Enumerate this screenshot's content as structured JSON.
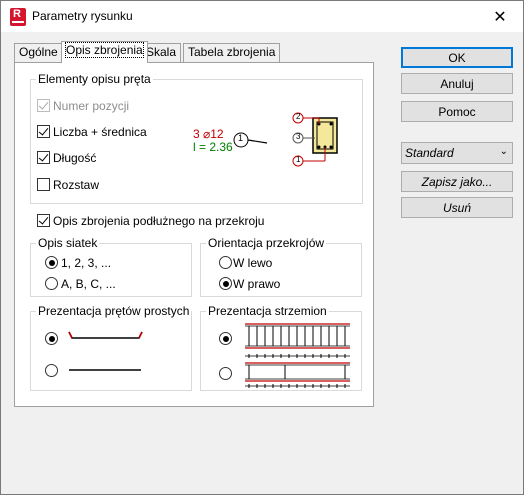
{
  "window": {
    "title": "Parametry rysunku",
    "app_icon_letter": "R"
  },
  "tabs": [
    {
      "label": "Ogólne"
    },
    {
      "label": "Opis zbrojenia"
    },
    {
      "label": "Skala"
    },
    {
      "label": "Tabela zbrojenia"
    }
  ],
  "elements_group": {
    "legend": "Elementy opisu pręta",
    "items": [
      {
        "label": "Numer pozycji",
        "checked": true,
        "disabled": true
      },
      {
        "label": "Liczba + średnica",
        "checked": true,
        "disabled": false
      },
      {
        "label": "Długość",
        "checked": true,
        "disabled": false
      },
      {
        "label": "Rozstaw",
        "checked": false,
        "disabled": false
      }
    ],
    "preview": {
      "count_diameter": "3 ⌀12",
      "length": "l = 2.36",
      "pos_main": "1",
      "pos_top": "2",
      "pos_mid": "3",
      "pos_bottom": "1",
      "count_color": "#c00000",
      "length_color": "#008000"
    }
  },
  "long_rebar_checkbox": {
    "label": "Opis zbrojenia podłużnego na przekroju",
    "checked": true
  },
  "mesh_group": {
    "legend": "Opis siatek",
    "options": [
      {
        "label": "1, 2, 3, ...",
        "selected": true
      },
      {
        "label": "A, B, C, ...",
        "selected": false
      }
    ]
  },
  "orientation_group": {
    "legend": "Orientacja przekrojów",
    "options": [
      {
        "label": "W lewo",
        "selected": false
      },
      {
        "label": "W prawo",
        "selected": true
      }
    ]
  },
  "straight_group": {
    "legend": "Prezentacja prętów prostych",
    "selected_index": 0
  },
  "stirrups_group": {
    "legend": "Prezentacja strzemion",
    "selected_index": 0
  },
  "buttons": {
    "ok": "OK",
    "cancel": "Anuluj",
    "help": "Pomoc",
    "save_as": "Zapisz jako...",
    "delete": "Usuń"
  },
  "style_select": {
    "value": "Standard"
  }
}
